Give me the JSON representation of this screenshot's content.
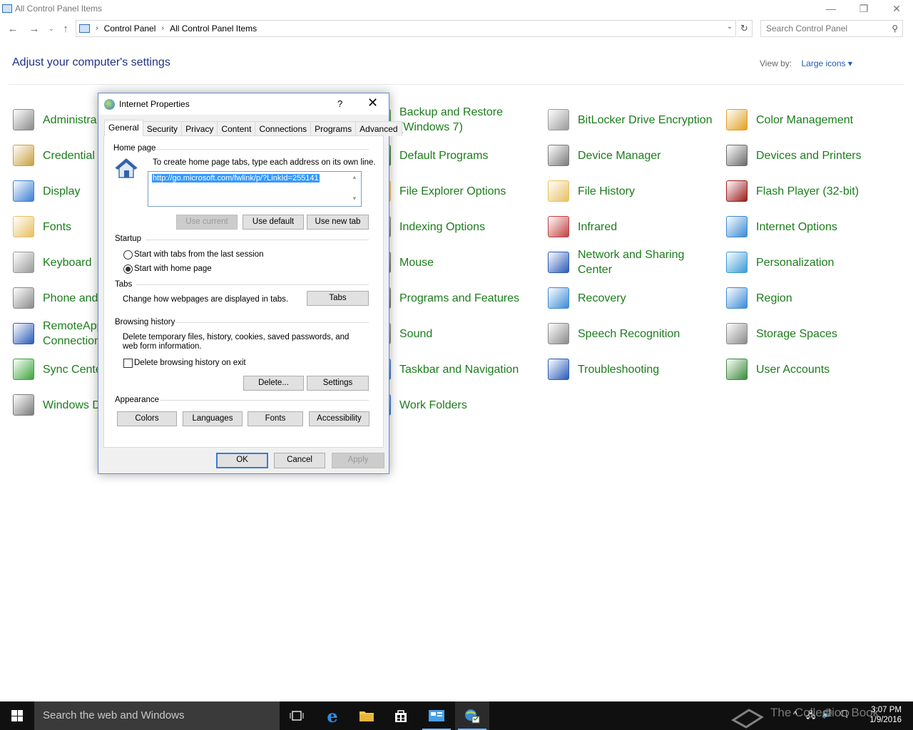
{
  "window": {
    "title": "All Control Panel Items",
    "controls": {
      "minimize": "—",
      "restore": "❐",
      "close": "✕"
    }
  },
  "address": {
    "crumbs": [
      "Control Panel",
      "All Control Panel Items"
    ],
    "search_placeholder": "Search Control Panel"
  },
  "header": {
    "title": "Adjust your computer's settings",
    "view_by_label": "View by:",
    "view_by_value": "Large icons"
  },
  "items": [
    {
      "label": "Administra",
      "icon": "admin-tools-icon",
      "color": "#8a8a8a"
    },
    {
      "label": "Backup and Restore\n(Windows 7)",
      "icon": "backup-icon",
      "color": "#4aa34a"
    },
    {
      "label": "BitLocker Drive Encryption",
      "icon": "bitlocker-icon",
      "color": "#9b9b9b"
    },
    {
      "label": "Color Management",
      "icon": "color-management-icon",
      "color": "#e0a020"
    },
    {
      "label": "Credential",
      "icon": "credential-icon",
      "color": "#c8a040"
    },
    {
      "label": "Default Programs",
      "icon": "default-programs-icon",
      "color": "#3b8a3b"
    },
    {
      "label": "Device Manager",
      "icon": "device-manager-icon",
      "color": "#7a7a7a"
    },
    {
      "label": "Devices and Printers",
      "icon": "printer-icon",
      "color": "#6a6a6a"
    },
    {
      "label": "Display",
      "icon": "display-icon",
      "color": "#3a7fd5"
    },
    {
      "label": "File Explorer Options",
      "icon": "folder-options-icon",
      "color": "#e8c060"
    },
    {
      "label": "File History",
      "icon": "file-history-icon",
      "color": "#e8c060"
    },
    {
      "label": "Flash Player (32-bit)",
      "icon": "flash-icon",
      "color": "#9b1b1b"
    },
    {
      "label": "Fonts",
      "icon": "fonts-icon",
      "color": "#e8c060"
    },
    {
      "label": "Indexing Options",
      "icon": "indexing-icon",
      "color": "#8a8a8a"
    },
    {
      "label": "Infrared",
      "icon": "infrared-icon",
      "color": "#c04040"
    },
    {
      "label": "Internet Options",
      "icon": "internet-options-icon",
      "color": "#3a8ad5"
    },
    {
      "label": "Keyboard",
      "icon": "keyboard-icon",
      "color": "#9a9a9a"
    },
    {
      "label": "Mouse",
      "icon": "mouse-icon",
      "color": "#7a7a7a"
    },
    {
      "label": "Network and Sharing\nCenter",
      "icon": "network-icon",
      "color": "#2a5ab8"
    },
    {
      "label": "Personalization",
      "icon": "personalization-icon",
      "color": "#3a9ad5"
    },
    {
      "label": "Phone and",
      "icon": "phone-icon",
      "color": "#8a8a8a"
    },
    {
      "label": "Programs and Features",
      "icon": "programs-icon",
      "color": "#7a7a7a"
    },
    {
      "label": "Recovery",
      "icon": "recovery-icon",
      "color": "#3a8ad5"
    },
    {
      "label": "Region",
      "icon": "region-icon",
      "color": "#3a8ad5"
    },
    {
      "label": "RemoteApp\nConnection",
      "icon": "remoteapp-icon",
      "color": "#2a5ab8"
    },
    {
      "label": "Sound",
      "icon": "sound-icon",
      "color": "#8a8a8a"
    },
    {
      "label": "Speech Recognition",
      "icon": "microphone-icon",
      "color": "#8a8a8a"
    },
    {
      "label": "Storage Spaces",
      "icon": "storage-icon",
      "color": "#8a8a8a"
    },
    {
      "label": "Sync Cente",
      "icon": "sync-icon",
      "color": "#3aa53a"
    },
    {
      "label": "Taskbar and Navigation",
      "icon": "taskbar-icon",
      "color": "#3a7fd5"
    },
    {
      "label": "Troubleshooting",
      "icon": "troubleshooting-icon",
      "color": "#2a5ab8"
    },
    {
      "label": "User Accounts",
      "icon": "user-accounts-icon",
      "color": "#3a8a3a"
    },
    {
      "label": "Windows D",
      "icon": "firewall-icon",
      "color": "#7a7a7a"
    },
    {
      "label": "Work Folders",
      "icon": "work-folders-icon",
      "color": "#3a7fd5"
    }
  ],
  "dialog": {
    "title": "Internet Properties",
    "help": "?",
    "close": "✕",
    "tabs": [
      "General",
      "Security",
      "Privacy",
      "Content",
      "Connections",
      "Programs",
      "Advanced"
    ],
    "active_tab": "General",
    "home_page": {
      "group": "Home page",
      "instructions": "To create home page tabs, type each address on its own line.",
      "url": "http://go.microsoft.com/fwlink/p/?LinkId=255141",
      "use_current": "Use current",
      "use_default": "Use default",
      "use_new_tab": "Use new tab"
    },
    "startup": {
      "group": "Startup",
      "option_last_session": "Start with tabs from the last session",
      "option_home_page": "Start with home page",
      "selected": "Start with home page"
    },
    "tabs_group": {
      "group": "Tabs",
      "description": "Change how webpages are displayed in tabs.",
      "button": "Tabs"
    },
    "browsing_history": {
      "group": "Browsing history",
      "description": "Delete temporary files, history, cookies, saved passwords, and web form information.",
      "checkbox": "Delete browsing history on exit",
      "checked": false,
      "delete": "Delete...",
      "settings": "Settings"
    },
    "appearance": {
      "group": "Appearance",
      "colors": "Colors",
      "languages": "Languages",
      "fonts": "Fonts",
      "accessibility": "Accessibility"
    },
    "footer": {
      "ok": "OK",
      "cancel": "Cancel",
      "apply": "Apply"
    }
  },
  "taskbar": {
    "search_text": "Search the web and Windows",
    "watermark": "The Collection Book",
    "time": "3:07 PM",
    "date": "1/9/2016"
  }
}
